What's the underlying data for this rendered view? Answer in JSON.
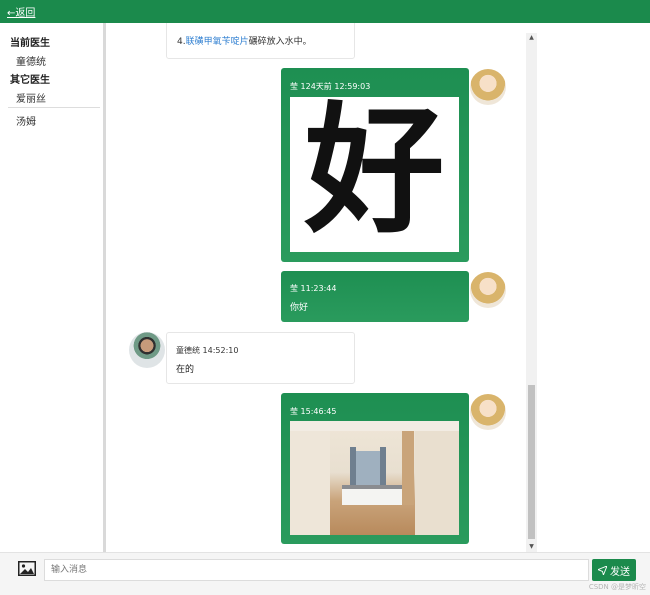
{
  "header": {
    "back_label": "←返回"
  },
  "sidebar": {
    "current_heading": "当前医生",
    "current_doctor": "童德统",
    "other_heading": "其它医生",
    "other_doctors": [
      "爱丽丝",
      "汤姆"
    ]
  },
  "messages": [
    {
      "side": "left",
      "partial_prefix": "4.",
      "link_text": "联磺甲氧苄啶片",
      "suffix": "碾碎放入水中。"
    },
    {
      "side": "right",
      "meta": "莹 124天前 12:59:03",
      "image_char": "好"
    },
    {
      "side": "right",
      "meta": "莹 11:23:44",
      "text": "你好"
    },
    {
      "side": "left",
      "meta": "童德统 14:52:10",
      "text": "在的"
    },
    {
      "side": "right",
      "meta": "莹 15:46:45",
      "image": "bedroom-photo"
    }
  ],
  "composer": {
    "placeholder": "输入消息",
    "send_label": "发送",
    "image_icon": "image-icon",
    "send_icon": "paper-plane-icon"
  },
  "watermark": "CSDN @是梦昕空",
  "colors": {
    "accent": "#1b8a4c",
    "bubble_green": "#2a9b5d"
  }
}
